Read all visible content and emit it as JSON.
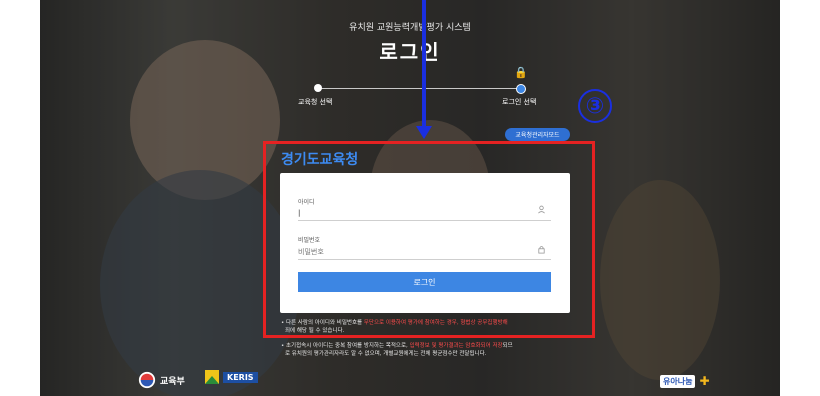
{
  "header": {
    "subtitle": "유치원 교원능력개발평가 시스템",
    "title": "로그인"
  },
  "steps": [
    {
      "label": "교육청 선택"
    },
    {
      "label": "로그인 선택"
    }
  ],
  "admin_mode_label": "교육청관리자모드",
  "annotation_number": "③",
  "org_title": "경기도교육청",
  "form": {
    "id_label": "아이디",
    "id_value": "|",
    "pw_label": "비밀번호",
    "pw_placeholder": "비밀번호",
    "login_button": "로그인"
  },
  "notice": {
    "line1_prefix": "• 다른 사람의 아이디와 비밀번호를 ",
    "line1_red": "무단으로 이용하여 평가에 참여하는 경우, 형법상 공무집행방해",
    "line1b": "죄에 해당 될 수 있습니다.",
    "line2_prefix": "• 초기접속시 아이디는 중복 참여를 방지하는 목적으로, ",
    "line2_red": "입력정보 및 평가결과는 암호화되어 저장",
    "line2_suffix": "되므",
    "line3": "로 유치원의 평가관리자라도 알 수 없으며, 개별교원에게는 전체 평균점수만 전달됩니다."
  },
  "footer": {
    "moe_label": "교육부",
    "keris_label": "KERIS",
    "right_logo_label": "유아나눔"
  },
  "colors": {
    "accent_blue": "#3d86e3",
    "annotation_blue": "#1a2fe0",
    "highlight_red": "#e52222"
  }
}
